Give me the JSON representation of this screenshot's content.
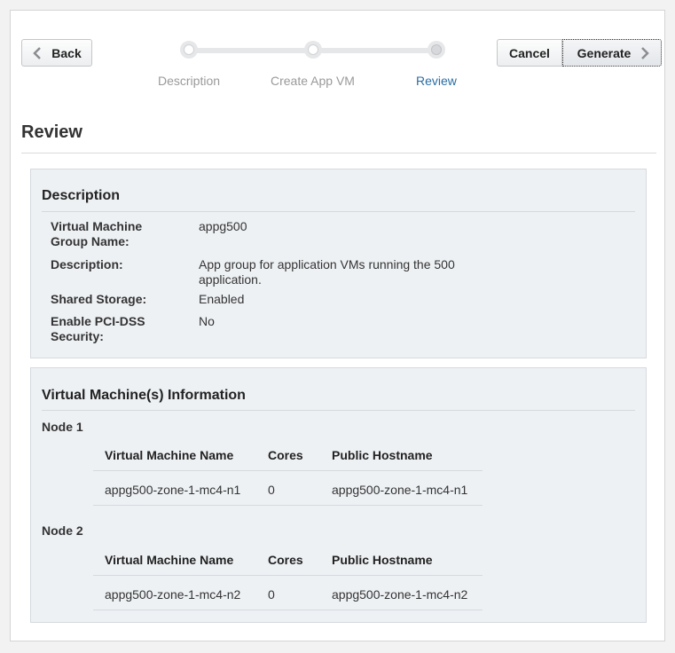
{
  "toolbar": {
    "back_label": "Back",
    "cancel_label": "Cancel",
    "generate_label": "Generate"
  },
  "train": {
    "steps": [
      {
        "label": "Description",
        "state": "visited"
      },
      {
        "label": "Create App VM",
        "state": "visited"
      },
      {
        "label": "Review",
        "state": "current"
      }
    ]
  },
  "page": {
    "title": "Review"
  },
  "description": {
    "heading": "Description",
    "fields": [
      {
        "label": "Virtual Machine Group Name:",
        "value": "appg500"
      },
      {
        "label": "Description:",
        "value": "App group for application VMs running the 500 application."
      },
      {
        "label": "Shared Storage:",
        "value": "Enabled"
      },
      {
        "label": "Enable PCI-DSS Security:",
        "value": "No"
      }
    ]
  },
  "vm_info": {
    "heading": "Virtual Machine(s) Information",
    "columns": [
      "Virtual Machine Name",
      "Cores",
      "Public Hostname"
    ],
    "nodes": [
      {
        "label": "Node 1",
        "rows": [
          {
            "name": "appg500-zone-1-mc4-n1",
            "cores": "0",
            "hostname": "appg500-zone-1-mc4-n1"
          }
        ]
      },
      {
        "label": "Node 2",
        "rows": [
          {
            "name": "appg500-zone-1-mc4-n2",
            "cores": "0",
            "hostname": "appg500-zone-1-mc4-n2"
          }
        ]
      }
    ]
  },
  "colors": {
    "accent": "#2b6ea3",
    "panel_bg": "#eef1f4",
    "inactive_text": "#9a9a9a"
  },
  "icons": {
    "back": "chevron-left-icon",
    "generate": "chevron-right-icon"
  }
}
